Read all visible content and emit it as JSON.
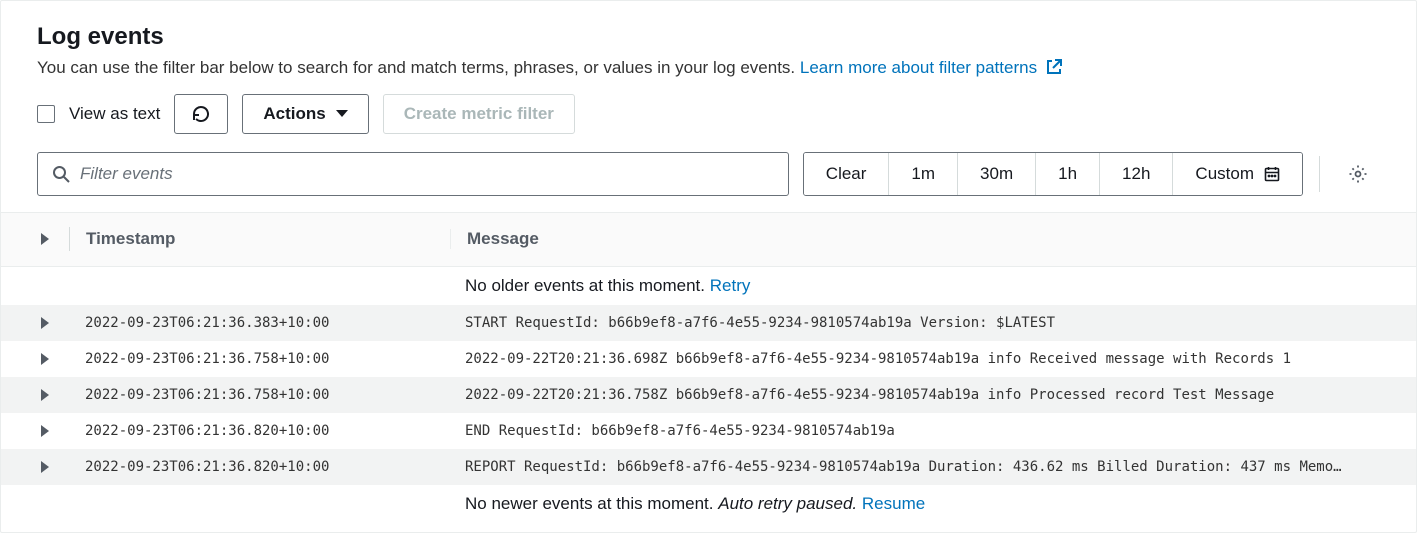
{
  "header": {
    "title": "Log events",
    "subtitle_text": "You can use the filter bar below to search for and match terms, phrases, or values in your log events. ",
    "learn_link": "Learn more about filter patterns"
  },
  "toolbar": {
    "view_as_text": "View as text",
    "refresh_title": "Refresh",
    "actions": "Actions",
    "create_metric": "Create metric filter"
  },
  "filter": {
    "placeholder": "Filter events",
    "clear": "Clear",
    "r1": "1m",
    "r2": "30m",
    "r3": "1h",
    "r4": "12h",
    "custom": "Custom"
  },
  "columns": {
    "timestamp": "Timestamp",
    "message": "Message"
  },
  "info_top": {
    "text": "No older events at this moment. ",
    "action": "Retry"
  },
  "info_bottom": {
    "text": "No newer events at this moment. ",
    "paused": "Auto retry paused.",
    "action": "Resume"
  },
  "rows": [
    {
      "ts": "2022-09-23T06:21:36.383+10:00",
      "msg": "START RequestId: b66b9ef8-a7f6-4e55-9234-9810574ab19a Version: $LATEST"
    },
    {
      "ts": "2022-09-23T06:21:36.758+10:00",
      "msg": "2022-09-22T20:21:36.698Z b66b9ef8-a7f6-4e55-9234-9810574ab19a info Received message with Records 1"
    },
    {
      "ts": "2022-09-23T06:21:36.758+10:00",
      "msg": "2022-09-22T20:21:36.758Z b66b9ef8-a7f6-4e55-9234-9810574ab19a info Processed record Test Message"
    },
    {
      "ts": "2022-09-23T06:21:36.820+10:00",
      "msg": "END RequestId: b66b9ef8-a7f6-4e55-9234-9810574ab19a"
    },
    {
      "ts": "2022-09-23T06:21:36.820+10:00",
      "msg": "REPORT RequestId: b66b9ef8-a7f6-4e55-9234-9810574ab19a Duration: 436.62 ms Billed Duration: 437 ms Memo…"
    }
  ]
}
